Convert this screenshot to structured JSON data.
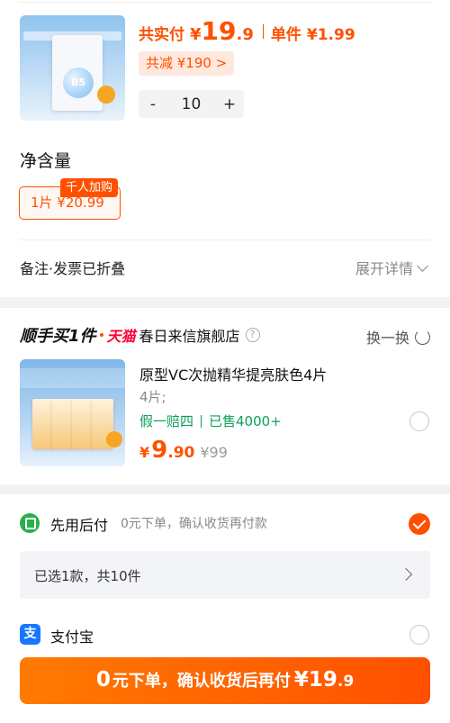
{
  "order": {
    "total_label": "共实付",
    "currency": "¥",
    "total_int": "19",
    "total_dec": ".9",
    "unit_label": "单件",
    "unit_price": "¥1.99",
    "reduce_tag": "共减 ¥190 >",
    "stepper": {
      "minus": "-",
      "qty": "10",
      "plus": "+"
    }
  },
  "spec": {
    "title": "净含量",
    "chip_label": "1片  ¥20.99",
    "badge": "千人加购"
  },
  "notes": {
    "label": "备注·发票已折叠",
    "expand": "展开详情"
  },
  "addon": {
    "brand": "顺手买1件",
    "tmall": "天猫",
    "store": "春日来信旗舰店",
    "help": "?",
    "swap": "换一换",
    "title": "原型VC次抛精华提亮肤色4片",
    "spec": "4片;",
    "tag1": "假一赔四",
    "tag2": "已售4000+",
    "currency": "¥",
    "price_int": "9",
    "price_dec": ".90",
    "orig_price": "¥99"
  },
  "payment": {
    "option1_name": "先用后付",
    "option1_desc": "0元下单，确认收货再付款",
    "selected_summary": "已选1款，共10件",
    "option2_name": "支付宝",
    "alipay_glyph": "支",
    "submit_zero": "0",
    "submit_text": "元下单，确认收货后再付",
    "submit_amount": "¥19",
    "submit_amount_dec": ".9"
  },
  "colors": {
    "accent": "#ff5000",
    "green": "#0aa15a",
    "alipay": "#1677ff"
  }
}
